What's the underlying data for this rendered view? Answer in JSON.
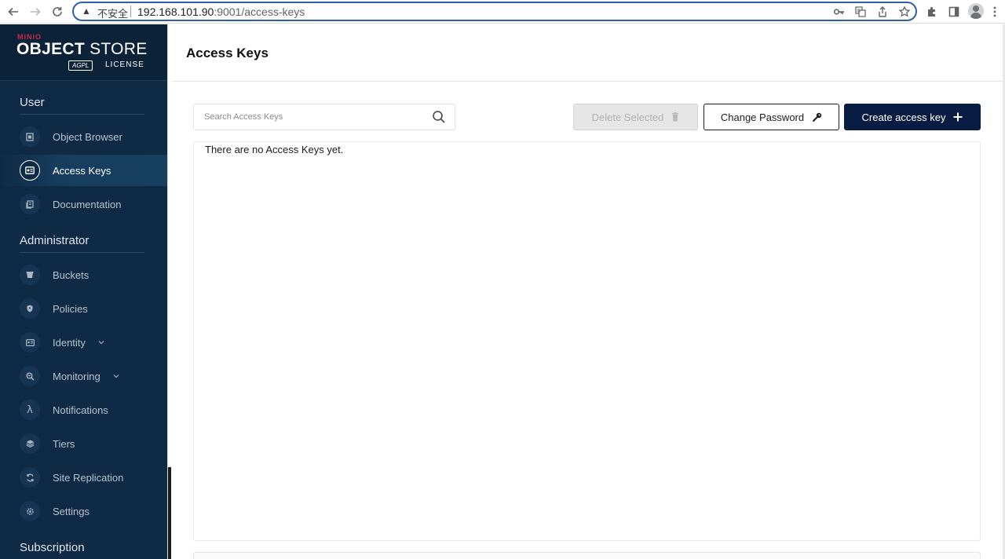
{
  "browser": {
    "security_label": "不安全",
    "url_host": "192.168.101.90",
    "url_rest": ":9001/access-keys"
  },
  "brand": {
    "company": "MINIO",
    "product_bold": "OBJECT",
    "product_light": " STORE",
    "badge": "AGPL",
    "license": "LICENSE"
  },
  "sidebar": {
    "sections": {
      "user": "User",
      "administrator": "Administrator",
      "subscription": "Subscription"
    },
    "user_items": [
      {
        "label": "Object Browser",
        "icon": "object-browser-icon"
      },
      {
        "label": "Access Keys",
        "icon": "access-keys-icon",
        "active": true
      },
      {
        "label": "Documentation",
        "icon": "documentation-icon"
      }
    ],
    "admin_items": [
      {
        "label": "Buckets",
        "icon": "buckets-icon"
      },
      {
        "label": "Policies",
        "icon": "policies-icon"
      },
      {
        "label": "Identity",
        "icon": "identity-icon",
        "expandable": true
      },
      {
        "label": "Monitoring",
        "icon": "monitoring-icon",
        "expandable": true
      },
      {
        "label": "Notifications",
        "icon": "lambda-icon"
      },
      {
        "label": "Tiers",
        "icon": "tiers-icon"
      },
      {
        "label": "Site Replication",
        "icon": "site-replication-icon"
      },
      {
        "label": "Settings",
        "icon": "settings-icon"
      }
    ]
  },
  "main": {
    "title": "Access Keys",
    "search_placeholder": "Search Access Keys",
    "search_value": "",
    "buttons": {
      "delete": "Delete Selected",
      "change_password": "Change Password",
      "create": "Create access key"
    },
    "empty_message": "There are no Access Keys yet."
  },
  "colors": {
    "sidebar_bg": "#0f2a44",
    "primary_button": "#081c42",
    "brand_red": "#c72c48"
  }
}
